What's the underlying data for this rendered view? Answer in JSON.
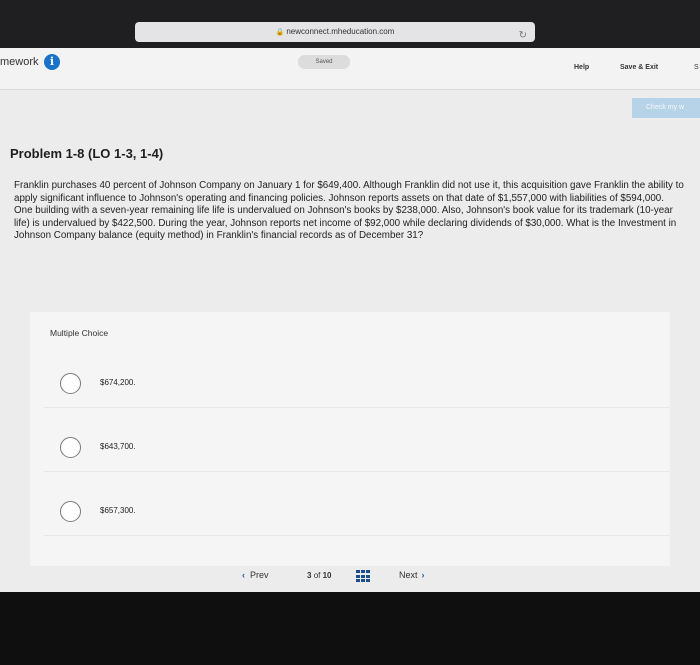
{
  "browser": {
    "url": "newconnect.mheducation.com",
    "lock_icon": "lock-icon",
    "reload_icon": "reload-icon"
  },
  "header": {
    "homework_label": "mework",
    "info_icon": "i",
    "saved_status": "Saved",
    "help_label": "Help",
    "save_exit_label": "Save & Exit",
    "overflow_label": "S",
    "check_work_label": "Check my w"
  },
  "problem": {
    "title": "Problem 1-8 (LO 1-3, 1-4)",
    "text": "Franklin purchases 40 percent of Johnson Company on January 1 for $649,400. Although Franklin did not use it, this acquisition gave Franklin the ability to apply significant influence to Johnson's operating and financing policies. Johnson reports assets on that date of $1,557,000 with liabilities of $594,000. One building with a seven-year remaining life life is undervalued on Johnson's books by $238,000. Also, Johnson's book value for its trademark (10-year life) is undervalued by $422,500. During the year, Johnson reports net income of $92,000 while declaring dividends of $30,000. What is the Investment in Johnson Company balance (equity method) in Franklin's financial records as of December 31?"
  },
  "multiple_choice": {
    "label": "Multiple Choice",
    "options": [
      {
        "value": "$674,200."
      },
      {
        "value": "$643,700."
      },
      {
        "value": "$657,300."
      }
    ]
  },
  "pager": {
    "prev_label": "Prev",
    "prev_chevron": "‹",
    "current": "3",
    "of_label": "of",
    "total": "10",
    "next_label": "Next",
    "next_chevron": "›"
  }
}
